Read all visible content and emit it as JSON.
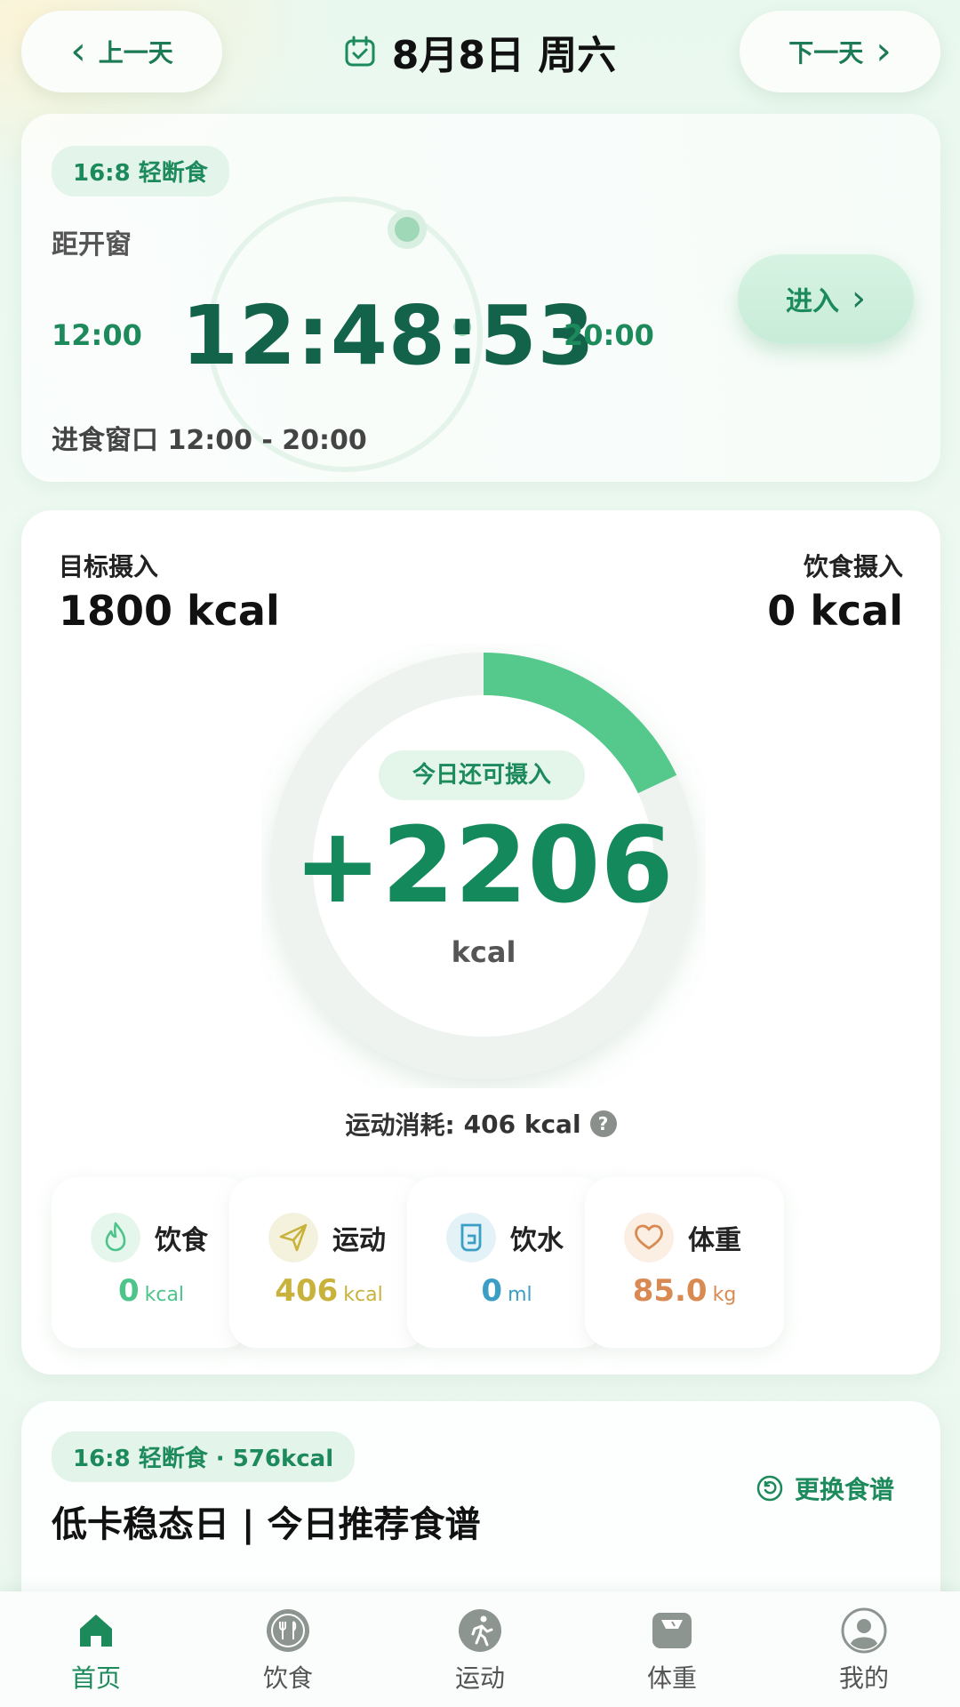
{
  "header": {
    "prev_label": "上一天",
    "next_label": "下一天",
    "date": "8月8日 周六"
  },
  "fasting": {
    "plan": "16:8 轻断食",
    "status": "距开窗",
    "countdown": "12:48:53",
    "start": "12:00",
    "end": "20:00",
    "window_text": "进食窗口 12:00 - 20:00",
    "enter_label": "进入"
  },
  "calories": {
    "target_label": "目标摄入",
    "target_value": "1800 kcal",
    "intake_label": "饮食摄入",
    "intake_value": "0 kcal",
    "remaining_label": "今日还可摄入",
    "remaining_value": "+2206",
    "remaining_unit": "kcal",
    "burn_label": "运动消耗:",
    "burn_value": "406 kcal",
    "help_glyph": "?",
    "ring_progress": 0.18,
    "ring_color": "#55c98b"
  },
  "stats": [
    {
      "name": "饮食",
      "value": "0",
      "unit": "kcal",
      "color": "#4cc48a",
      "icon": "flame-icon"
    },
    {
      "name": "运动",
      "value": "406",
      "unit": "kcal",
      "color": "#c9b23c",
      "icon": "send-icon"
    },
    {
      "name": "饮水",
      "value": "0",
      "unit": "ml",
      "color": "#3a9ec5",
      "icon": "water-cup-icon"
    },
    {
      "name": "体重",
      "value": "85.0",
      "unit": "kg",
      "color": "#d98a52",
      "icon": "heart-icon"
    }
  ],
  "recipe": {
    "tag": "16:8 轻断食 · 576kcal",
    "title": "低卡稳态日 | 今日推荐食谱",
    "swap_label": "更换食谱"
  },
  "nav": [
    {
      "label": "首页",
      "icon": "home-icon",
      "active": true
    },
    {
      "label": "饮食",
      "icon": "fork-knife-icon",
      "active": false
    },
    {
      "label": "运动",
      "icon": "running-icon",
      "active": false
    },
    {
      "label": "体重",
      "icon": "scale-icon",
      "active": false
    },
    {
      "label": "我的",
      "icon": "profile-icon",
      "active": false
    }
  ],
  "colors": {
    "accent": "#1d8a5c",
    "accent_light": "#e3f4ea"
  }
}
